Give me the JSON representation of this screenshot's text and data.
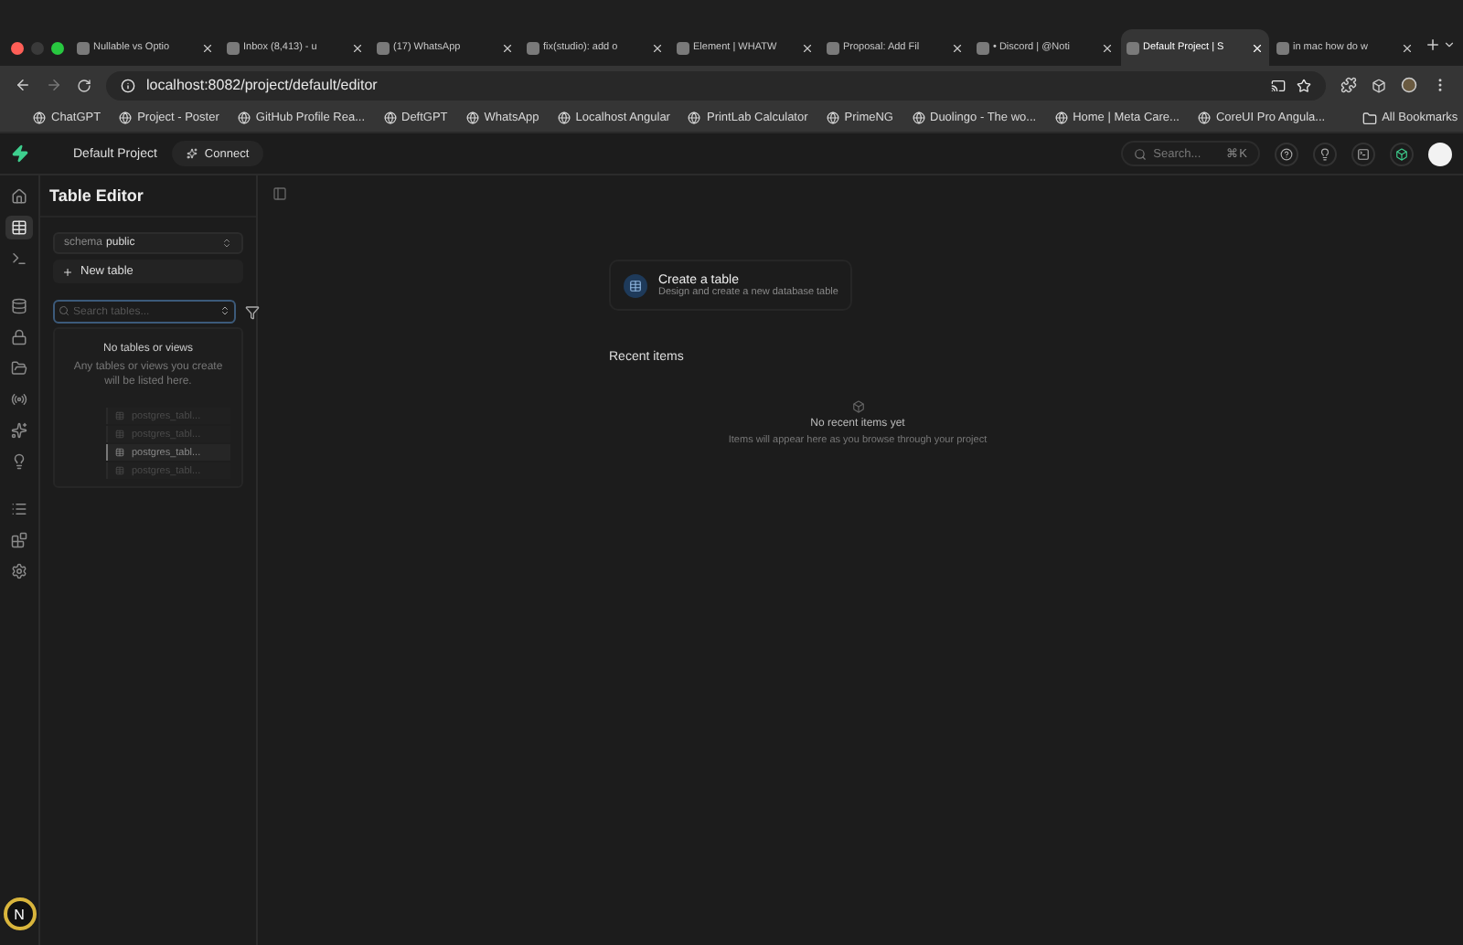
{
  "browser": {
    "tabs": [
      {
        "title": "Nullable vs Optio",
        "selected": false
      },
      {
        "title": "Inbox (8,413) - u",
        "selected": false
      },
      {
        "title": "(17) WhatsApp",
        "selected": false
      },
      {
        "title": "fix(studio): add o",
        "selected": false
      },
      {
        "title": "Element | WHATW",
        "selected": false
      },
      {
        "title": "Proposal: Add Fil",
        "selected": false
      },
      {
        "title": "• Discord | @Noti",
        "selected": false
      },
      {
        "title": "Default Project | S",
        "selected": true
      },
      {
        "title": "in mac how do w",
        "selected": false
      }
    ],
    "url": "localhost:8082/project/default/editor",
    "bookmarks": [
      "ChatGPT",
      "Project - Poster",
      "GitHub Profile Rea...",
      "DeftGPT",
      "WhatsApp",
      "Localhost Angular",
      "PrintLab Calculator",
      "PrimeNG",
      "Duolingo - The wo...",
      "Home | Meta Care...",
      "CoreUI Pro Angula..."
    ],
    "all_bookmarks": "All Bookmarks"
  },
  "header": {
    "project": "Default Project",
    "connect": "Connect",
    "search": {
      "placeholder": "Search...",
      "shortcut": "⌘K"
    }
  },
  "nav_rail": [
    {
      "selected": false
    },
    {
      "selected": true
    },
    {
      "selected": false
    },
    {
      "selected": false
    },
    {
      "selected": false
    },
    {
      "selected": false
    },
    {
      "selected": false
    },
    {
      "selected": false
    },
    {
      "selected": false
    },
    {
      "selected": false
    },
    {
      "selected": false
    },
    {
      "selected": false
    }
  ],
  "user_avatar": "N",
  "panel": {
    "title": "Table Editor",
    "schema_label": "schema",
    "schema": "public",
    "new_table": "New table",
    "search": {
      "placeholder": "Search tables..."
    },
    "empty_title": "No tables or views",
    "empty_text": "Any tables or views you create will be listed here.",
    "sample_rows": [
      {
        "label": "postgres_tabl...",
        "selected": false
      },
      {
        "label": "postgres_tabl...",
        "selected": false
      },
      {
        "label": "postgres_tabl...",
        "selected": true
      },
      {
        "label": "postgres_tabl...",
        "selected": false
      }
    ]
  },
  "main": {
    "create": {
      "title": "Create a table",
      "subtitle": "Design and create a new database table"
    },
    "recent_title": "Recent items",
    "recent_empty_title": "No recent items yet",
    "recent_empty_text": "Items will appear here as you browse through your project"
  }
}
